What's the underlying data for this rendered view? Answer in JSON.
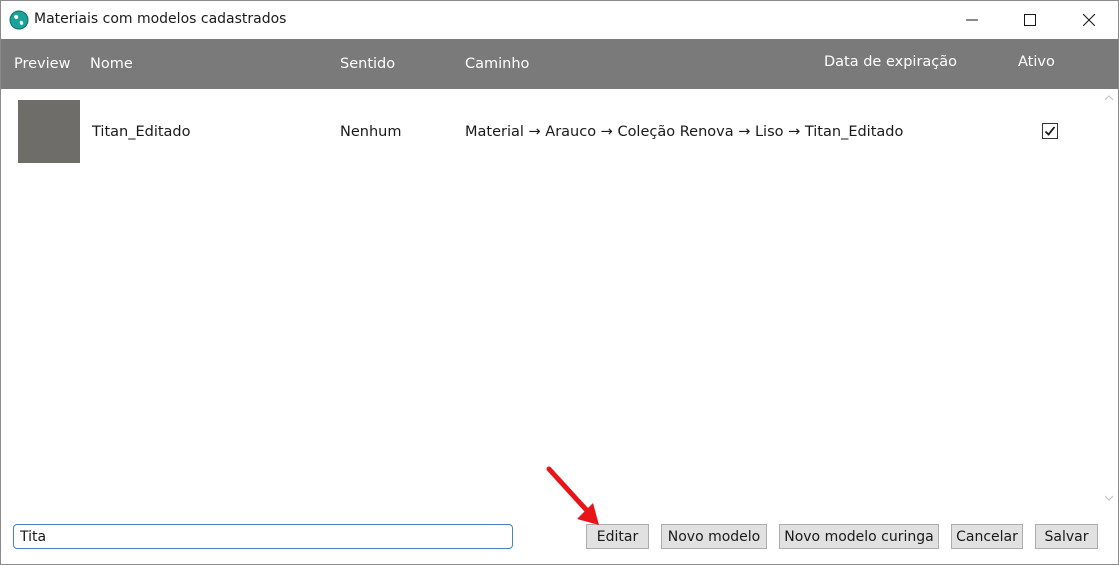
{
  "window": {
    "title": "Materiais com modelos cadastrados"
  },
  "header": {
    "columns": [
      "Preview",
      "Nome",
      "Sentido",
      "Caminho",
      "Data de expiração",
      "Ativo"
    ]
  },
  "rows": [
    {
      "nome": "Titan_Editado",
      "sentido": "Nenhum",
      "caminho": "Material → Arauco → Coleção Renova → Liso → Titan_Editado",
      "data_expiracao": "",
      "ativo": true,
      "preview_color": "#6f6d6a"
    }
  ],
  "footer": {
    "search_value": "Tita",
    "buttons": {
      "editar": "Editar",
      "novo_modelo": "Novo modelo",
      "novo_modelo_curinga": "Novo modelo curinga",
      "cancelar": "Cancelar",
      "salvar": "Salvar"
    }
  },
  "colors": {
    "header_bg": "#7a7a7a",
    "input_border": "#4a7fc1",
    "annotation_arrow": "#e8141a",
    "app_icon": "#1aa39a"
  },
  "icons": {
    "app": "globe-icon",
    "minimize": "minimize-icon",
    "maximize": "maximize-icon",
    "close": "close-icon",
    "check": "check-icon",
    "annotation": "red-arrow-annotation"
  }
}
